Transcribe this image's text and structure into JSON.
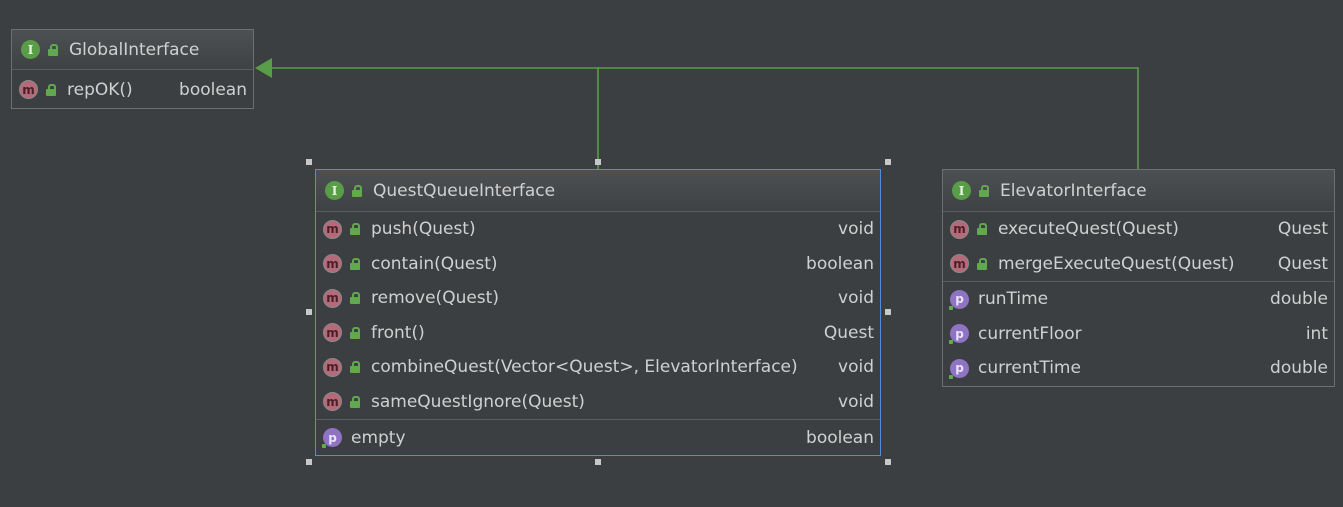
{
  "nodes": {
    "global_interface": {
      "title": "GlobalInterface",
      "kind": "interface",
      "methods": [
        {
          "name": "repOK()",
          "type": "boolean"
        }
      ],
      "properties": []
    },
    "quest_queue_interface": {
      "title": "QuestQueueInterface",
      "kind": "interface",
      "selected": true,
      "methods": [
        {
          "name": "push(Quest)",
          "type": "void"
        },
        {
          "name": "contain(Quest)",
          "type": "boolean"
        },
        {
          "name": "remove(Quest)",
          "type": "void"
        },
        {
          "name": "front()",
          "type": "Quest"
        },
        {
          "name": "combineQuest(Vector<Quest>, ElevatorInterface)",
          "type": "void"
        },
        {
          "name": "sameQuestIgnore(Quest)",
          "type": "void"
        }
      ],
      "properties": [
        {
          "name": "empty",
          "type": "boolean"
        }
      ]
    },
    "elevator_interface": {
      "title": "ElevatorInterface",
      "kind": "interface",
      "methods": [
        {
          "name": "executeQuest(Quest)",
          "type": "Quest"
        },
        {
          "name": "mergeExecuteQuest(Quest)",
          "type": "Quest"
        }
      ],
      "properties": [
        {
          "name": "runTime",
          "type": "double"
        },
        {
          "name": "currentFloor",
          "type": "int"
        },
        {
          "name": "currentTime",
          "type": "double"
        }
      ]
    }
  },
  "icons": {
    "interface_badge": {
      "glyph": "I",
      "color": "#5a9d49"
    },
    "method_badge": {
      "glyph": "m",
      "color": "#b56a7a"
    },
    "property_badge": {
      "glyph": "p",
      "color": "#8f73c4"
    },
    "public_modifier": "lock-icon"
  },
  "colors": {
    "background": "#3c3f41",
    "edge": "#5a9d49",
    "selection_border": "#4f8fd6"
  },
  "edges": [
    {
      "from": "QuestQueueInterface",
      "to": "GlobalInterface",
      "relation": "extends"
    },
    {
      "from": "ElevatorInterface",
      "to": "GlobalInterface",
      "relation": "extends"
    }
  ]
}
